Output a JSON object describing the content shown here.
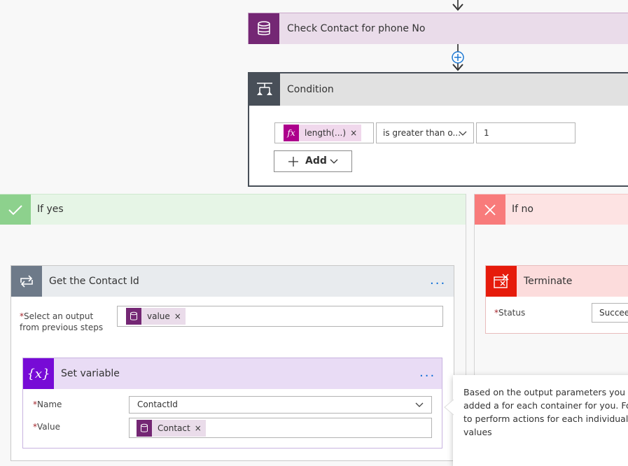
{
  "check_step": {
    "title": "Check Contact for phone No"
  },
  "condition": {
    "title": "Condition",
    "left_token": "length(...)",
    "left_token_remove": "×",
    "operator": "is greater than o...",
    "right_value": "1",
    "add_label": "Add"
  },
  "if_yes": {
    "title": "If yes"
  },
  "if_no": {
    "title": "If no"
  },
  "get_contact": {
    "title": "Get the Contact Id",
    "menu": "...",
    "field_required": "*",
    "field_label_line1": "Select an output",
    "field_label_line2": "from previous steps",
    "token": "value",
    "token_remove": "×"
  },
  "set_variable": {
    "title": "Set variable",
    "menu": "...",
    "name_required": "*",
    "name_label": "Name",
    "name_value": "ContactId",
    "value_required": "*",
    "value_label": "Value",
    "value_token": "Contact",
    "value_token_remove": "×"
  },
  "terminate": {
    "title": "Terminate",
    "status_required": "*",
    "status_label": "Status",
    "status_value": "Succeed"
  },
  "tooltip": {
    "line1": "Based on the output parameters you s",
    "line2": "added a for each container for you. Fo",
    "line3": "to perform actions for each individual",
    "line4": "values"
  },
  "colors": {
    "database": "#742774",
    "condition": "#484f58",
    "yes": "#8dd18d",
    "no": "#f87b7b",
    "loop": "#6e7a89",
    "variable": "#770bd6",
    "terminate": "#e61b0b",
    "expression": "#ad008c"
  }
}
